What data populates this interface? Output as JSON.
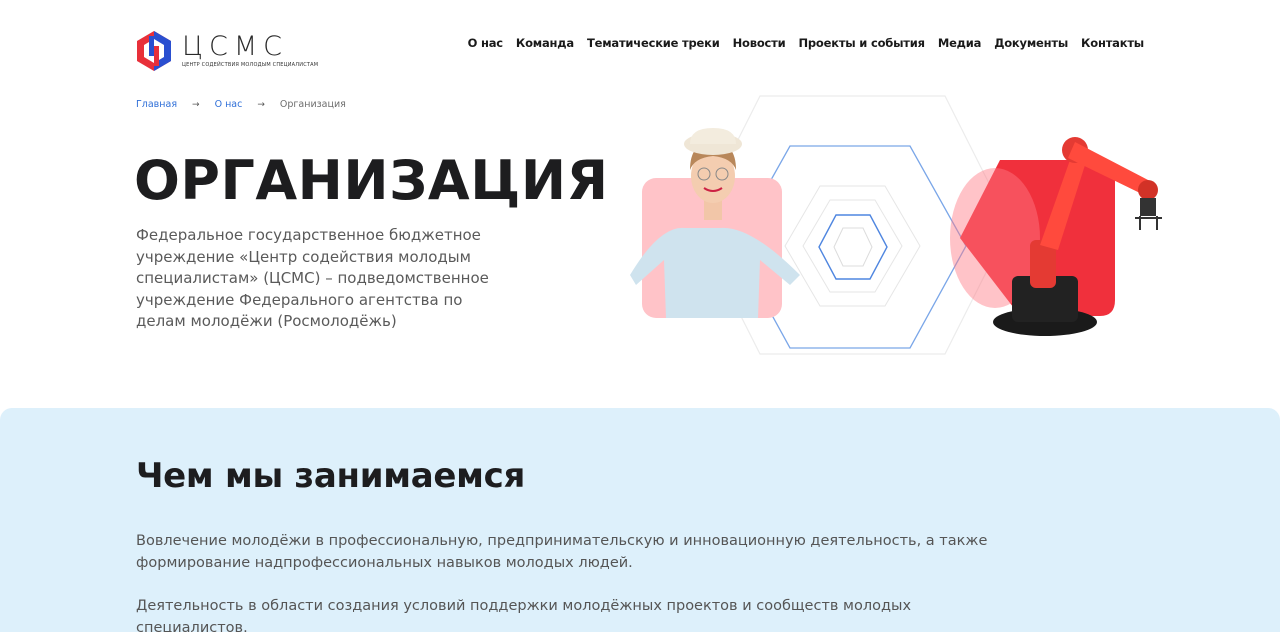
{
  "header": {
    "logo_word": "ЦСМС",
    "logo_subtitle": "ЦЕНТР СОДЕЙСТВИЯ МОЛОДЫМ СПЕЦИАЛИСТАМ",
    "nav": [
      {
        "label": "О нас"
      },
      {
        "label": "Команда"
      },
      {
        "label": "Тематические треки"
      },
      {
        "label": "Новости"
      },
      {
        "label": "Проекты и события"
      },
      {
        "label": "Медиа"
      },
      {
        "label": "Документы"
      },
      {
        "label": "Контакты"
      }
    ]
  },
  "breadcrumb": {
    "items": [
      {
        "label": "Главная"
      },
      {
        "label": "О нас"
      },
      {
        "label": "Организация"
      }
    ],
    "separator": "→"
  },
  "hero": {
    "title": "ОРГАНИЗАЦИЯ",
    "description": "Федеральное государственное бюджетное учреждение «Центр содействия молодым специалистам» (ЦСМС) – подведомственное учреждение Федерального агентства по делам молодёжи (Росмолодёжь)"
  },
  "section": {
    "title": "Чем мы занимаемся",
    "paragraphs": [
      "Вовлечение молодёжи в профессиональную, предпринимательскую и инновационную деятельность, а также формирование надпрофессиональных навыков молодых людей.",
      "Деятельность в области создания условий поддержки молодёжных проектов и сообществ молодых специалистов."
    ]
  },
  "colors": {
    "accent_blue": "#2f6fd8",
    "logo_red": "#e8303a",
    "logo_blue": "#2a4fd0",
    "section_bg": "#ddf0fb",
    "pink_tile": "#ffc3c8",
    "red_tile": "#f0303c"
  }
}
